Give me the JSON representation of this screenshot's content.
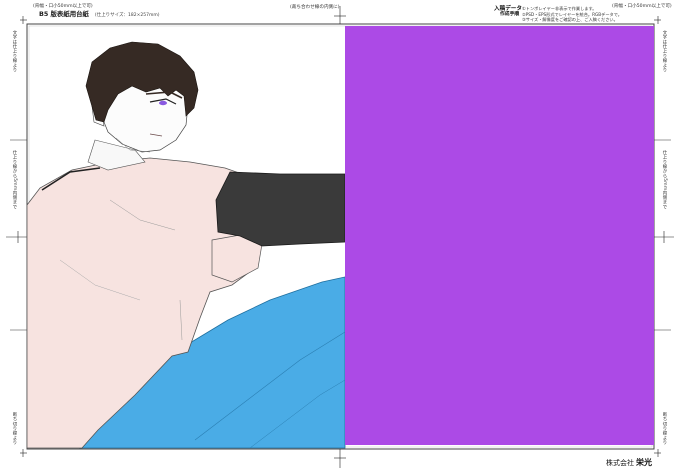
{
  "header": {
    "title": "B5 版表紙用台紙",
    "size_note": "(仕上りサイズ：182×257mm)",
    "top_left_note": "(背幅・口小50mm以上で可)",
    "top_center_note": "(裁ち合わせ線の内側に)",
    "top_right_note": "(背幅・口小50mm以上で可)"
  },
  "instructions": {
    "heading_line1": "入稿データ",
    "heading_line2": "作成手順",
    "items": [
      "①トンボレイヤー非表示で作業します。",
      "②PSD・EPS形式でレイヤーを統合。RGBデータで。",
      "③サイズ・解像度をご確認の上、ご入稿ください。"
    ]
  },
  "side_labels": {
    "left_top": "文字は仕上り線より",
    "left_mid": "仕上り線から5mm内側まで",
    "left_bottom": "断ち切り線より",
    "right_top": "文字は仕上り線より",
    "right_mid": "仕上り線から5mm内側まで",
    "right_bottom": "断ち切り線より"
  },
  "footer": {
    "company_prefix": "株式会社",
    "company_name": "栄光"
  },
  "art": {
    "purple_panel_color": "#AC4AE6",
    "shirt_color": "#F7E3E0",
    "pants_color": "#4AACE6",
    "sleeve_color": "#3A3A3A",
    "hair_color": "#362A24",
    "eye_color": "#8A5AE0"
  }
}
